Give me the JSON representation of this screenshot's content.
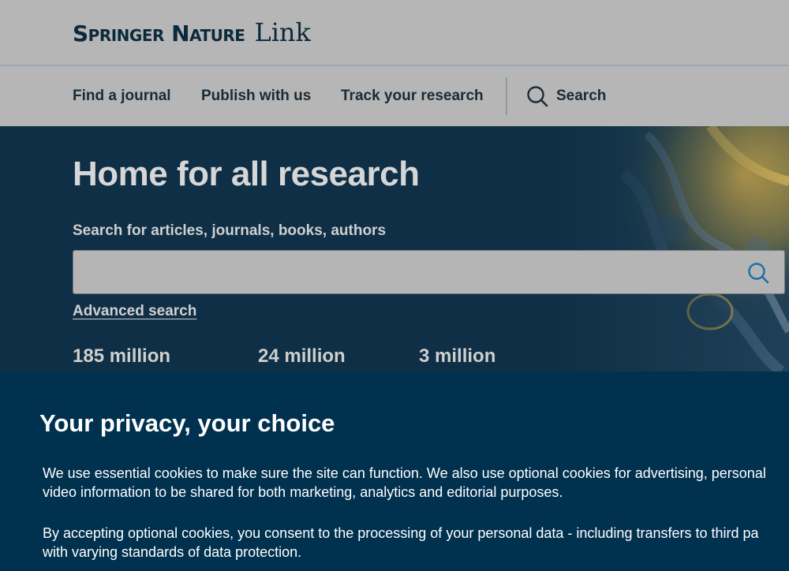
{
  "header": {
    "brand": "Springer Nature",
    "product": "Link"
  },
  "nav": {
    "items": [
      {
        "label": "Find a journal"
      },
      {
        "label": "Publish with us"
      },
      {
        "label": "Track your research"
      }
    ],
    "search_label": "Search"
  },
  "hero": {
    "title": "Home for all research",
    "search_label": "Search for articles, journals, books, authors",
    "search_value": "",
    "advanced_search": "Advanced search",
    "stats": [
      {
        "value": "185 million"
      },
      {
        "value": "24 million"
      },
      {
        "value": "3 million"
      }
    ]
  },
  "cookie": {
    "title": "Your privacy, your choice",
    "para1_line1": "We use essential cookies to make sure the site can function. We also use optional cookies for advertising, personal",
    "para1_line2": "video information to be shared for both marketing, analytics and editorial purposes.",
    "para2_line1": "By accepting optional cookies, you consent to the processing of your personal data - including transfers to third pa",
    "para2_line2": "with varying standards of data protection."
  },
  "colors": {
    "header_bg": "#b6b6b6",
    "hero_bg": "#0e2f45",
    "cookie_bg": "#00314f",
    "accent_blue": "#1b6fa8"
  }
}
